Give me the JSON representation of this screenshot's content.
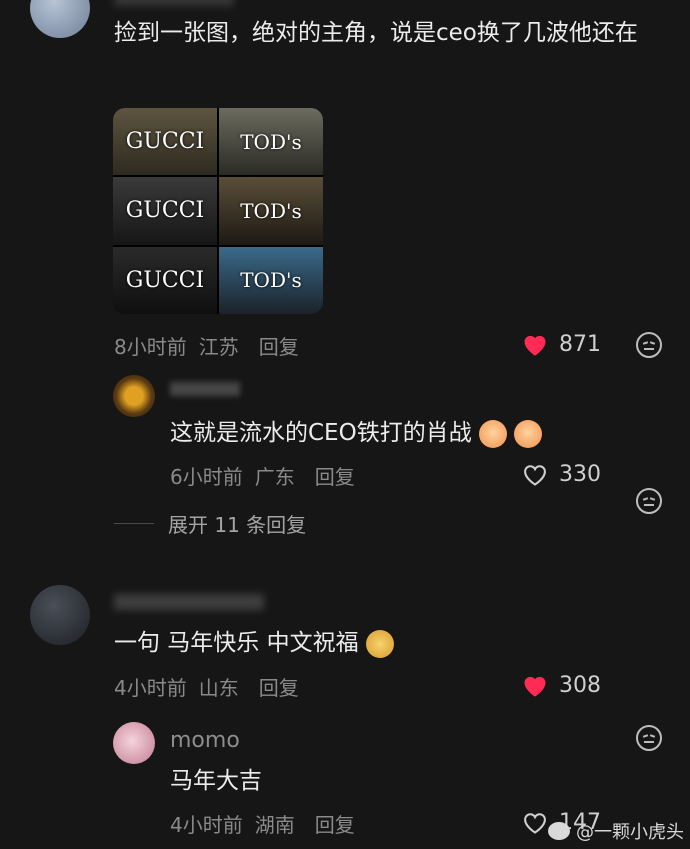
{
  "comments": [
    {
      "name": "",
      "text": "捡到一张图，绝对的主角，说是ceo换了几波他还在",
      "time": "8小时前",
      "location": "江苏",
      "reply_label": "回复",
      "likes": "871",
      "liked": true,
      "image_labels": [
        "GUCCI",
        "TOD's",
        "GUCCI",
        "TOD's",
        "GUCCI",
        "TOD's"
      ]
    },
    {
      "name": "",
      "text": "这就是流水的CEO铁打的肖战",
      "time": "6小时前",
      "location": "广东",
      "reply_label": "回复",
      "likes": "330",
      "liked": false
    },
    {
      "name": "",
      "text": "一句 马年快乐 中文祝福",
      "time": "4小时前",
      "location": "山东",
      "reply_label": "回复",
      "likes": "308",
      "liked": true
    },
    {
      "name": "momo",
      "text": "马年大吉",
      "time": "4小时前",
      "location": "湖南",
      "reply_label": "回复",
      "likes": "147",
      "liked": false
    }
  ],
  "expand_label": "展开 11 条回复",
  "watermark": "@一颗小虎头",
  "colors": {
    "heart": "#ff2b54",
    "background": "#161616"
  }
}
